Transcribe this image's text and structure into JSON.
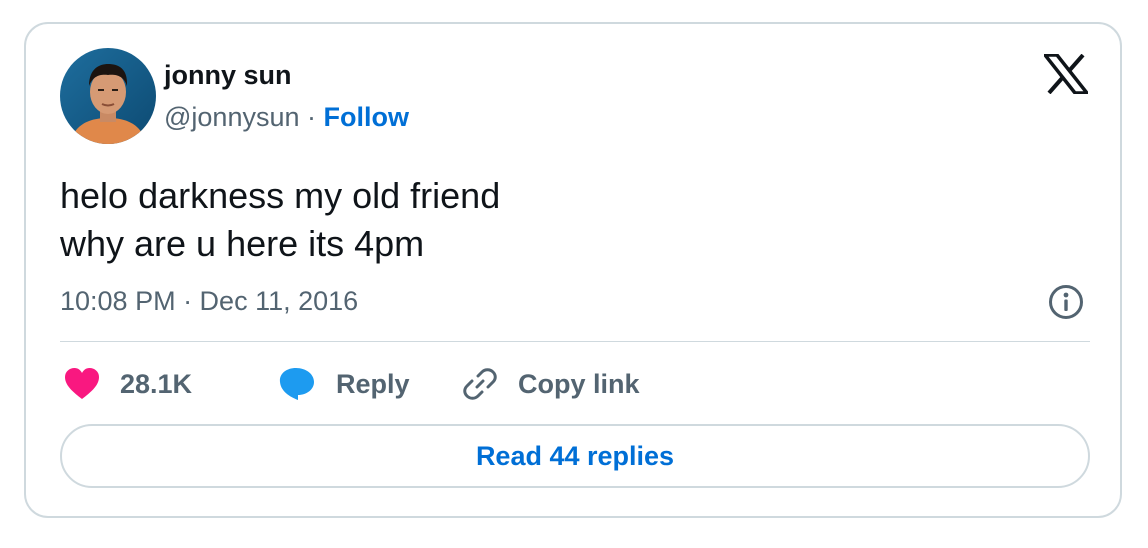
{
  "author": {
    "name": "jonny sun",
    "handle": "@jonnysun",
    "separator": " · ",
    "follow_label": "Follow"
  },
  "tweet": {
    "lines": [
      "helo darkness my old friend",
      "why are u here its 4pm"
    ],
    "timestamp": "10:08 PM · Dec 11, 2016"
  },
  "actions": {
    "likes": "28.1K",
    "reply_label": "Reply",
    "copy_link_label": "Copy link"
  },
  "read_replies_label": "Read 44 replies",
  "icons": {
    "brand": "x-logo-icon",
    "info": "info-icon",
    "like": "heart-icon",
    "reply": "speech-bubble-icon",
    "copy": "link-icon"
  },
  "colors": {
    "like": "#f91880",
    "reply": "#1d9bf0",
    "follow": "#006fd6",
    "muted": "#536471",
    "text": "#0f1419",
    "border": "#cfd9de"
  }
}
